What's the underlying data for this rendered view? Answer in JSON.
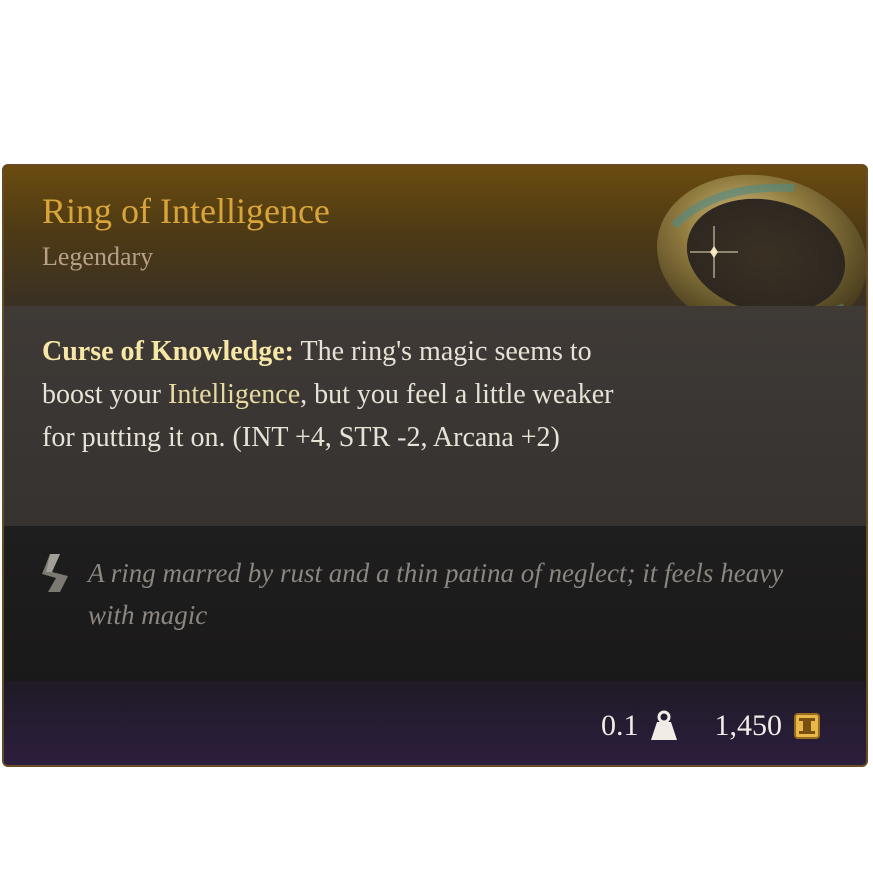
{
  "item": {
    "name": "Ring of Intelligence",
    "rarity": "Legendary",
    "image": "ring-icon",
    "description": {
      "title": "Curse of Knowledge:",
      "text_before": " The ring's magic seems to boost your ",
      "highlight": "Intelligence",
      "text_after": ", but you feel a little weaker for putting it on. (INT +4, STR -2, Arcana +2)"
    },
    "flavor_text": "A ring marred by rust and a thin patina of neglect; it feels heavy with magic",
    "flavor_icon": "scroll-quill-icon",
    "weight": "0.1",
    "weight_icon": "weight-icon",
    "value": "1,450",
    "value_icon": "gold-coin-icon"
  },
  "colors": {
    "title": "#d9a53a",
    "rarity": "#b89f88",
    "highlight": "#f6e7a6",
    "flavor": "#8b8680"
  }
}
